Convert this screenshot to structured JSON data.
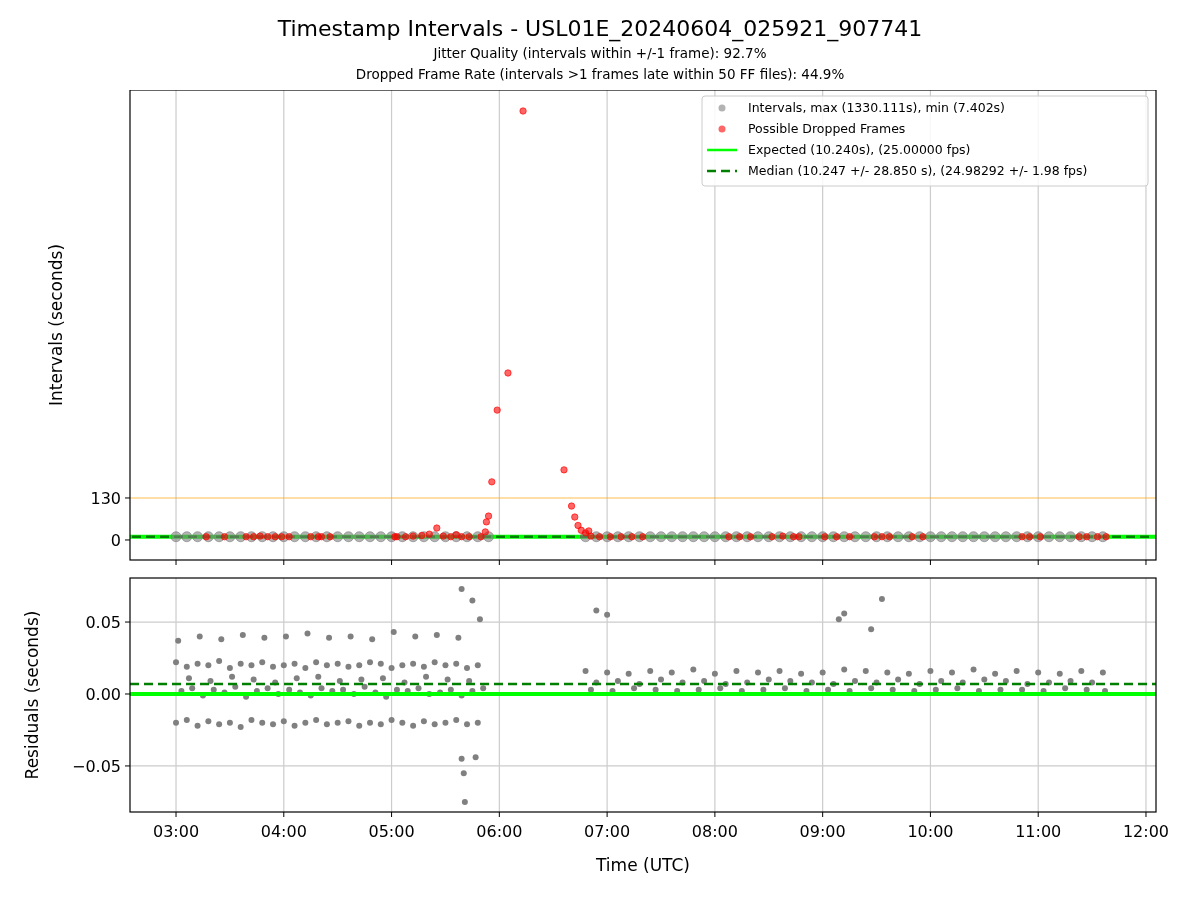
{
  "figure": {
    "title": "Timestamp Intervals - USL01E_20240604_025921_907741",
    "subtitles": [
      "Jitter Quality (intervals within +/-1 frame): 92.7%",
      "Dropped Frame Rate (intervals >1 frames late within 50 FF files): 44.9%"
    ]
  },
  "top_chart": {
    "chart_data": {
      "type": "scatter",
      "ylabel": "Intervals (seconds)",
      "xlim": [
        2.573,
        12.093
      ],
      "ylim": [
        -62,
        1393
      ],
      "grid": true,
      "yticks": [
        {
          "value": 0,
          "label": "0"
        },
        {
          "value": 130,
          "label": "130"
        }
      ],
      "series": [
        {
          "name": "Intervals, max (1330.111s), min (7.402s)",
          "color": "#808080",
          "x": [
            3.0,
            3.1,
            3.2,
            3.3,
            3.4,
            3.5,
            3.6,
            3.7,
            3.8,
            3.9,
            4.0,
            4.1,
            4.2,
            4.3,
            4.4,
            4.5,
            4.6,
            4.7,
            4.8,
            4.9,
            5.0,
            5.1,
            5.2,
            5.3,
            5.4,
            5.5,
            5.6,
            5.7,
            5.8,
            5.9,
            6.8,
            6.9,
            7.0,
            7.1,
            7.2,
            7.3,
            7.4,
            7.5,
            7.6,
            7.7,
            7.8,
            7.9,
            8.0,
            8.1,
            8.2,
            8.3,
            8.4,
            8.5,
            8.6,
            8.7,
            8.8,
            8.9,
            9.0,
            9.1,
            9.2,
            9.3,
            9.4,
            9.5,
            9.6,
            9.7,
            9.8,
            9.9,
            10.0,
            10.1,
            10.2,
            10.3,
            10.4,
            10.5,
            10.6,
            10.7,
            10.8,
            10.9,
            11.0,
            11.1,
            11.2,
            11.3,
            11.4,
            11.5,
            11.6
          ],
          "values": [
            10,
            10,
            10,
            10,
            10,
            10,
            10,
            10,
            10,
            10,
            10,
            10,
            10,
            10,
            10,
            10,
            10,
            10,
            10,
            10,
            10,
            10,
            10,
            10,
            10,
            10,
            10,
            10,
            10,
            10,
            10,
            10,
            10,
            10,
            10,
            10,
            10,
            10,
            10,
            10,
            10,
            10,
            10,
            10,
            10,
            10,
            10,
            10,
            10,
            10,
            10,
            10,
            10,
            10,
            10,
            10,
            10,
            10,
            10,
            10,
            10,
            10,
            10,
            10,
            10,
            10,
            10,
            10,
            10,
            10,
            10,
            10,
            10,
            10,
            10,
            10,
            10,
            10,
            10
          ]
        },
        {
          "name": "Possible Dropped Frames",
          "color": "#ff0000",
          "x": [
            3.28,
            3.45,
            3.65,
            3.72,
            3.78,
            3.85,
            3.92,
            3.98,
            4.05,
            4.25,
            4.32,
            4.35,
            4.43,
            5.03,
            5.05,
            5.13,
            5.2,
            5.28,
            5.35,
            5.42,
            5.48,
            5.55,
            5.6,
            5.65,
            5.72,
            5.83,
            5.87,
            5.88,
            5.9,
            5.93,
            5.98,
            6.08,
            6.22,
            6.6,
            6.67,
            6.7,
            6.73,
            6.76,
            6.8,
            6.83,
            6.85,
            6.93,
            7.03,
            7.13,
            7.23,
            7.33,
            8.13,
            8.23,
            8.33,
            8.53,
            8.63,
            8.73,
            8.78,
            9.02,
            9.13,
            9.25,
            9.48,
            9.55,
            9.62,
            9.83,
            9.93,
            10.85,
            10.92,
            11.02,
            11.38,
            11.45,
            11.55,
            11.63
          ],
          "values": [
            10,
            10,
            10,
            10,
            12,
            10,
            10,
            10,
            10,
            10,
            10,
            10,
            10,
            10,
            10,
            10,
            12,
            14,
            18,
            37,
            12,
            10,
            16,
            10,
            10,
            10,
            25,
            56,
            74,
            180,
            402,
            517,
            1328,
            217,
            105,
            71,
            45,
            30,
            22,
            28,
            12,
            10,
            10,
            10,
            10,
            10,
            10,
            10,
            10,
            10,
            12,
            10,
            10,
            10,
            10,
            10,
            10,
            10,
            10,
            10,
            10,
            10,
            10,
            10,
            10,
            10,
            10,
            10
          ]
        }
      ],
      "legend": true,
      "ref_lines": [
        {
          "axis": "y",
          "value": 130,
          "color": "#ffa500"
        },
        {
          "axis": "y",
          "value": 10.24,
          "color": "#00ff00",
          "label": "Expected (10.240s), (25.00000 fps)"
        },
        {
          "axis": "y",
          "value": 10.247,
          "color": "#008000",
          "label": "Median (10.247 +/- 28.850 s), (24.98292 +/- 1.98 fps)"
        }
      ]
    }
  },
  "bottom_chart": {
    "chart_data": {
      "type": "scatter",
      "xlabel": "Time (UTC)",
      "ylabel": "Residuals (seconds)",
      "xlim": [
        2.573,
        12.093
      ],
      "ylim": [
        -0.082,
        0.0806
      ],
      "grid": true,
      "xticks": [
        {
          "value": 3,
          "label": "03:00"
        },
        {
          "value": 4,
          "label": "04:00"
        },
        {
          "value": 5,
          "label": "05:00"
        },
        {
          "value": 6,
          "label": "06:00"
        },
        {
          "value": 7,
          "label": "07:00"
        },
        {
          "value": 8,
          "label": "08:00"
        },
        {
          "value": 9,
          "label": "09:00"
        },
        {
          "value": 10,
          "label": "10:00"
        },
        {
          "value": 11,
          "label": "11:00"
        },
        {
          "value": 12,
          "label": "12:00"
        }
      ],
      "yticks": [
        {
          "value": -0.05,
          "label": "−0.05"
        },
        {
          "value": 0,
          "label": "0.00"
        },
        {
          "value": 0.05,
          "label": "0.05"
        }
      ],
      "series": [
        {
          "color": "#808080",
          "x": [
            3.0,
            3.1,
            3.2,
            3.3,
            3.4,
            3.5,
            3.6,
            3.7,
            3.8,
            3.9,
            4.0,
            4.1,
            4.2,
            4.3,
            4.4,
            4.5,
            4.6,
            4.7,
            4.8,
            4.9,
            5.0,
            5.1,
            5.2,
            5.3,
            5.4,
            5.5,
            5.6,
            5.7,
            5.8,
            3.05,
            3.15,
            3.25,
            3.35,
            3.45,
            3.55,
            3.65,
            3.75,
            3.85,
            3.95,
            4.05,
            4.15,
            4.25,
            4.35,
            4.45,
            4.55,
            4.65,
            4.75,
            4.85,
            4.95,
            5.05,
            5.15,
            5.25,
            5.35,
            5.45,
            5.55,
            5.65,
            5.75,
            5.85,
            3.0,
            3.1,
            3.2,
            3.3,
            3.4,
            3.5,
            3.6,
            3.7,
            3.8,
            3.9,
            4.0,
            4.1,
            4.2,
            4.3,
            4.4,
            4.5,
            4.6,
            4.7,
            4.8,
            4.9,
            5.0,
            5.1,
            5.2,
            5.3,
            5.4,
            5.5,
            5.6,
            5.7,
            5.8,
            3.02,
            3.22,
            3.42,
            3.62,
            3.82,
            4.02,
            4.22,
            4.42,
            4.62,
            4.82,
            5.02,
            5.22,
            5.42,
            5.62,
            3.12,
            3.32,
            3.52,
            3.72,
            3.92,
            4.12,
            4.32,
            4.52,
            4.72,
            4.92,
            5.12,
            5.32,
            5.52,
            5.72,
            6.8,
            7.0,
            7.2,
            7.4,
            7.6,
            7.8,
            8.0,
            8.2,
            8.4,
            8.6,
            8.8,
            9.0,
            9.2,
            9.4,
            9.6,
            9.8,
            10.0,
            10.2,
            10.4,
            10.6,
            10.8,
            11.0,
            11.2,
            11.4,
            11.6,
            6.9,
            7.1,
            7.3,
            7.5,
            7.7,
            7.9,
            8.1,
            8.3,
            8.5,
            8.7,
            8.9,
            9.1,
            9.3,
            9.5,
            9.7,
            9.9,
            10.1,
            10.3,
            10.5,
            10.7,
            10.9,
            11.1,
            11.3,
            11.5,
            6.85,
            7.05,
            7.25,
            7.45,
            7.65,
            7.85,
            8.05,
            8.25,
            8.45,
            8.65,
            8.85,
            9.05,
            9.25,
            9.45,
            9.65,
            9.85,
            10.05,
            10.25,
            10.45,
            10.65,
            10.85,
            11.05,
            11.25,
            11.45,
            11.62,
            5.65,
            5.75,
            5.82,
            5.65,
            5.67,
            5.68,
            5.78,
            6.9,
            7.0,
            9.15,
            9.2,
            9.55,
            9.45
          ],
          "values": [
            0.022,
            0.019,
            0.021,
            0.02,
            0.023,
            0.018,
            0.021,
            0.02,
            0.022,
            0.019,
            0.02,
            0.021,
            0.018,
            0.022,
            0.02,
            0.021,
            0.019,
            0.02,
            0.022,
            0.021,
            0.018,
            0.02,
            0.021,
            0.019,
            0.022,
            0.02,
            0.021,
            0.018,
            0.02,
            0.002,
            0.004,
            -0.001,
            0.003,
            0.001,
            0.005,
            -0.002,
            0.002,
            0.004,
            0.0,
            0.003,
            0.001,
            -0.001,
            0.004,
            0.002,
            0.003,
            0.0,
            0.005,
            0.001,
            -0.002,
            0.003,
            0.002,
            0.004,
            0.0,
            0.001,
            0.003,
            -0.001,
            0.002,
            0.004,
            -0.02,
            -0.018,
            -0.022,
            -0.019,
            -0.021,
            -0.02,
            -0.023,
            -0.018,
            -0.02,
            -0.021,
            -0.019,
            -0.022,
            -0.02,
            -0.018,
            -0.021,
            -0.02,
            -0.019,
            -0.022,
            -0.02,
            -0.021,
            -0.018,
            -0.02,
            -0.022,
            -0.019,
            -0.021,
            -0.02,
            -0.018,
            -0.021,
            -0.02,
            0.037,
            0.04,
            0.038,
            0.041,
            0.039,
            0.04,
            0.042,
            0.039,
            0.04,
            0.038,
            0.043,
            0.04,
            0.041,
            0.039,
            0.011,
            0.009,
            0.012,
            0.01,
            0.008,
            0.011,
            0.012,
            0.009,
            0.01,
            0.011,
            0.008,
            0.012,
            0.01,
            0.009,
            0.016,
            0.015,
            0.014,
            0.016,
            0.015,
            0.017,
            0.014,
            0.016,
            0.015,
            0.016,
            0.014,
            0.015,
            0.017,
            0.016,
            0.015,
            0.014,
            0.016,
            0.015,
            0.017,
            0.014,
            0.016,
            0.015,
            0.014,
            0.016,
            0.015,
            0.008,
            0.009,
            0.007,
            0.01,
            0.008,
            0.009,
            0.007,
            0.008,
            0.01,
            0.009,
            0.008,
            0.007,
            0.009,
            0.008,
            0.01,
            0.007,
            0.009,
            0.008,
            0.01,
            0.009,
            0.007,
            0.008,
            0.009,
            0.008,
            0.003,
            0.002,
            0.004,
            0.003,
            0.002,
            0.003,
            0.004,
            0.002,
            0.003,
            0.004,
            0.002,
            0.003,
            0.002,
            0.004,
            0.003,
            0.002,
            0.003,
            0.004,
            0.002,
            0.003,
            0.003,
            0.002,
            0.004,
            0.003,
            0.002,
            0.073,
            0.065,
            0.052,
            -0.045,
            -0.055,
            -0.075,
            -0.044,
            0.058,
            0.055,
            0.052,
            0.056,
            0.066,
            0.045
          ]
        }
      ],
      "ref_lines": [
        {
          "axis": "y",
          "value": 0,
          "color": "#00ff00"
        },
        {
          "axis": "y",
          "value": 0.007,
          "color": "#008000"
        }
      ]
    }
  }
}
